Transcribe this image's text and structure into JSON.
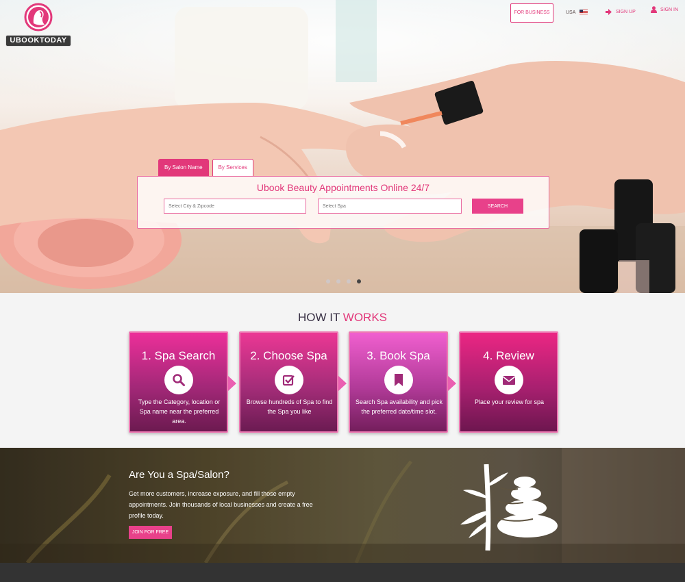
{
  "brand": {
    "name": "UBOOKTODAY",
    "accent": "#e2387a"
  },
  "nav": {
    "for_business": "FOR BUSINESS",
    "country": "USA",
    "sign_up": "SIGN UP",
    "sign_in": "SIGN IN"
  },
  "hero": {
    "tabs": [
      {
        "label": "By Salon Name",
        "active": true
      },
      {
        "label": "By Services",
        "active": false
      }
    ],
    "search_title": "Ubook Beauty Appointments Online 24/7",
    "city_placeholder": "Select City & Zipcode",
    "spa_placeholder": "Select Spa",
    "search_button": "SEARCH",
    "slider": {
      "count": 4,
      "active": 4
    }
  },
  "how": {
    "title_part1": "HOW IT",
    "title_part2": "WORKS",
    "steps": [
      {
        "title": "1. Spa Search",
        "icon": "search-icon",
        "text": "Type the Category, location or Spa name near the preferred area."
      },
      {
        "title": "2. Choose Spa",
        "icon": "checkbox-icon",
        "text": "Browse hundreds of Spa to find the Spa you like"
      },
      {
        "title": "3. Book Spa",
        "icon": "bookmark-icon",
        "text": "Search Spa availability and pick the preferred date/time slot."
      },
      {
        "title": "4. Review",
        "icon": "envelope-icon",
        "text": "Place your review for spa"
      }
    ]
  },
  "spa": {
    "title": "Are You a Spa/Salon?",
    "text": "Get more customers, increase exposure, and fill those empty appointments. Join thousands of local businesses and create a free profile today.",
    "join_button": "JOIN FOR FREE"
  }
}
